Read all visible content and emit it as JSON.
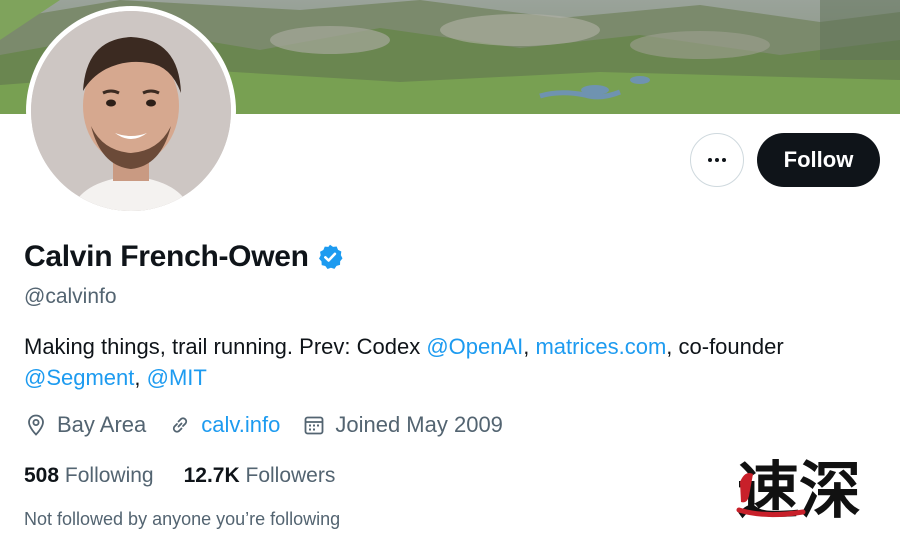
{
  "profile": {
    "name": "Calvin French-Owen",
    "handle": "@calvinfo",
    "bio": {
      "text_1": "Making things, trail running. Prev: Codex ",
      "mention_openai": "@OpenAI",
      "sep_1": ", ",
      "link_matrices": "matrices.com",
      "text_2": ", co-founder ",
      "mention_segment": "@Segment",
      "sep_2": ", ",
      "mention_mit": "@MIT"
    },
    "location": "Bay Area",
    "website": "calv.info",
    "joined": "Joined May 2009",
    "following_count": "508",
    "following_label": "Following",
    "followers_count": "12.7K",
    "followers_label": "Followers",
    "not_followed_text": "Not followed by anyone you’re following"
  },
  "actions": {
    "follow_label": "Follow",
    "more_icon": "more-horizontal-icon"
  },
  "icons": {
    "verified": "verified-badge-icon",
    "location": "location-pin-icon",
    "link": "link-icon",
    "calendar": "calendar-icon"
  },
  "colors": {
    "accent": "#1d9bf0",
    "text": "#0f1419",
    "secondary": "#536471",
    "follow_bg": "#0f1419"
  },
  "watermark": {
    "text": "速深"
  }
}
